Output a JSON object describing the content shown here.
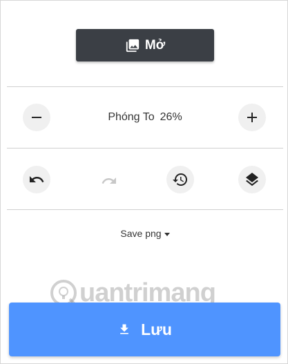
{
  "open_button": {
    "label": "Mở",
    "icon": "image-gallery-icon"
  },
  "zoom": {
    "label": "Phóng To",
    "value": "26%"
  },
  "toolbar": {
    "undo_icon": "undo-icon",
    "redo_icon": "redo-icon",
    "history_icon": "history-icon",
    "layers_icon": "layers-icon"
  },
  "save_format": {
    "label": "Save png"
  },
  "watermark": {
    "text": "uantrimang"
  },
  "save_button": {
    "label": "Lưu",
    "icon": "download-icon"
  },
  "colors": {
    "open_button_bg": "#3b3f45",
    "save_button_bg": "#4f94ff",
    "round_button_bg": "#f0f0f0",
    "redo_disabled": "#c8c8c8"
  }
}
